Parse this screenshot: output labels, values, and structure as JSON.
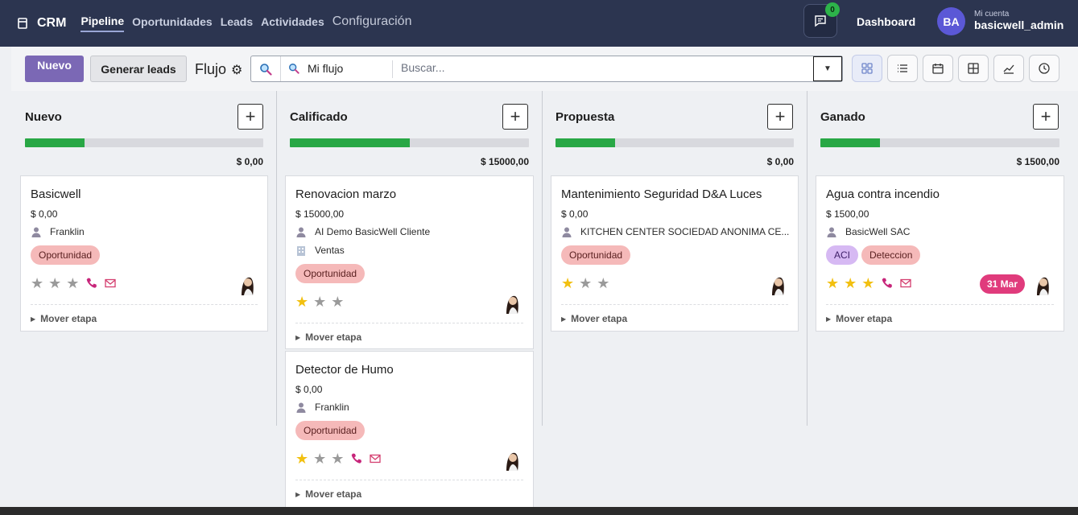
{
  "app": {
    "name": "CRM"
  },
  "nav": {
    "links": [
      "Pipeline",
      "Oportunidades",
      "Leads",
      "Actividades"
    ],
    "config_label": "Configuración",
    "chat_badge": "0",
    "dashboard_label": "Dashboard",
    "avatar_initials": "BA",
    "account_label": "Mi cuenta",
    "account_name": "basicwell_admin"
  },
  "toolbar": {
    "new_label": "Nuevo",
    "generate_label": "Generar leads",
    "view_name": "Flujo",
    "facet_label": "Mi flujo",
    "search_placeholder": "Buscar...",
    "views": [
      "kanban-icon",
      "list-icon",
      "calendar-icon",
      "pivot-icon",
      "graph-icon",
      "activity-icon"
    ]
  },
  "columns": [
    {
      "title": "Nuevo",
      "progress": 0.25,
      "total": "$ 0,00",
      "cards": [
        {
          "title": "Basicwell",
          "amount": "$ 0,00",
          "contact": "Franklin",
          "tags": [
            "Oportunidad"
          ],
          "stars": 0,
          "phone": true,
          "mail": true
        }
      ]
    },
    {
      "title": "Calificado",
      "progress": 0.5,
      "total": "$ 15000,00",
      "cards": [
        {
          "title": "Renovacion marzo",
          "amount": "$ 15000,00",
          "contact": "AI Demo BasicWell Cliente",
          "team": "Ventas",
          "tags": [
            "Oportunidad"
          ],
          "stars": 1
        },
        {
          "title": "Detector de Humo",
          "amount": "$ 0,00",
          "contact": "Franklin",
          "tags": [
            "Oportunidad"
          ],
          "stars": 1,
          "phone": true,
          "mail": true
        }
      ]
    },
    {
      "title": "Propuesta",
      "progress": 0.25,
      "total": "$ 0,00",
      "cards": [
        {
          "title": "Mantenimiento Seguridad D&A Luces",
          "amount": "$ 0,00",
          "contact": "KITCHEN CENTER SOCIEDAD ANONIMA CE...",
          "tags": [
            "Oportunidad"
          ],
          "stars": 1
        }
      ]
    },
    {
      "title": "Ganado",
      "progress": 0.25,
      "total": "$ 1500,00",
      "cards": [
        {
          "title": "Agua contra incendio",
          "amount": "$ 1500,00",
          "contact": "BasicWell SAC",
          "tags": [
            "ACI",
            "Deteccion"
          ],
          "stars": 3,
          "phone": true,
          "mail": true,
          "deadline": "31 Mar"
        }
      ]
    }
  ],
  "mover_label": "Mover etapa",
  "colors": {
    "topbar": "#2c3550",
    "primary": "#7b68b5",
    "progress": "#28a745",
    "star": "#f2c010",
    "deadline": "#e03b7c",
    "tag_red": "#f5b9b9",
    "tag_purple": "#d6b9f3"
  }
}
